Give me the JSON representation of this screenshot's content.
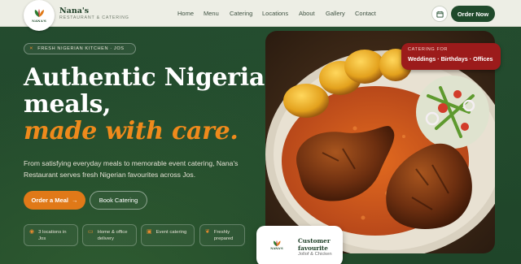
{
  "brand": {
    "name": "Nana's",
    "tagline": "RESTAURANT & CATERING",
    "logo_text": "NANA'S"
  },
  "nav": {
    "items": [
      "Home",
      "Menu",
      "Catering",
      "Locations",
      "About",
      "Gallery",
      "Contact"
    ],
    "order_label": "Order Now",
    "calendar_icon": "calendar-icon"
  },
  "hero": {
    "eyebrow": "FRESH NIGERIAN KITCHEN · JOS",
    "title_line1": "Authentic Nigerian",
    "title_line2": "meals,",
    "title_line3": "made with care.",
    "subtitle": "From satisfying everyday meals to memorable event catering, Nana's Restaurant serves fresh Nigerian favourites across Jos.",
    "primary_cta": "Order a Meal",
    "primary_cta_arrow": "→",
    "secondary_cta": "Book Catering"
  },
  "features": [
    {
      "icon": "location-pin-icon",
      "label": "3 locations in Jos"
    },
    {
      "icon": "delivery-truck-icon",
      "label": "Home & office delivery"
    },
    {
      "icon": "calendar-icon",
      "label": "Event catering"
    },
    {
      "icon": "leaf-icon",
      "label": "Freshly prepared"
    }
  ],
  "catering_badge": {
    "small": "CATERING FOR",
    "big": "Weddings · Birthdays · Offices"
  },
  "favourite": {
    "title": "Customer favourite",
    "dish": "Jollof & Chicken"
  },
  "colors": {
    "bg_green": "#234a2e",
    "accent_orange": "#e07918",
    "badge_red": "#9c1b1b",
    "header_bg": "#edeee5"
  }
}
